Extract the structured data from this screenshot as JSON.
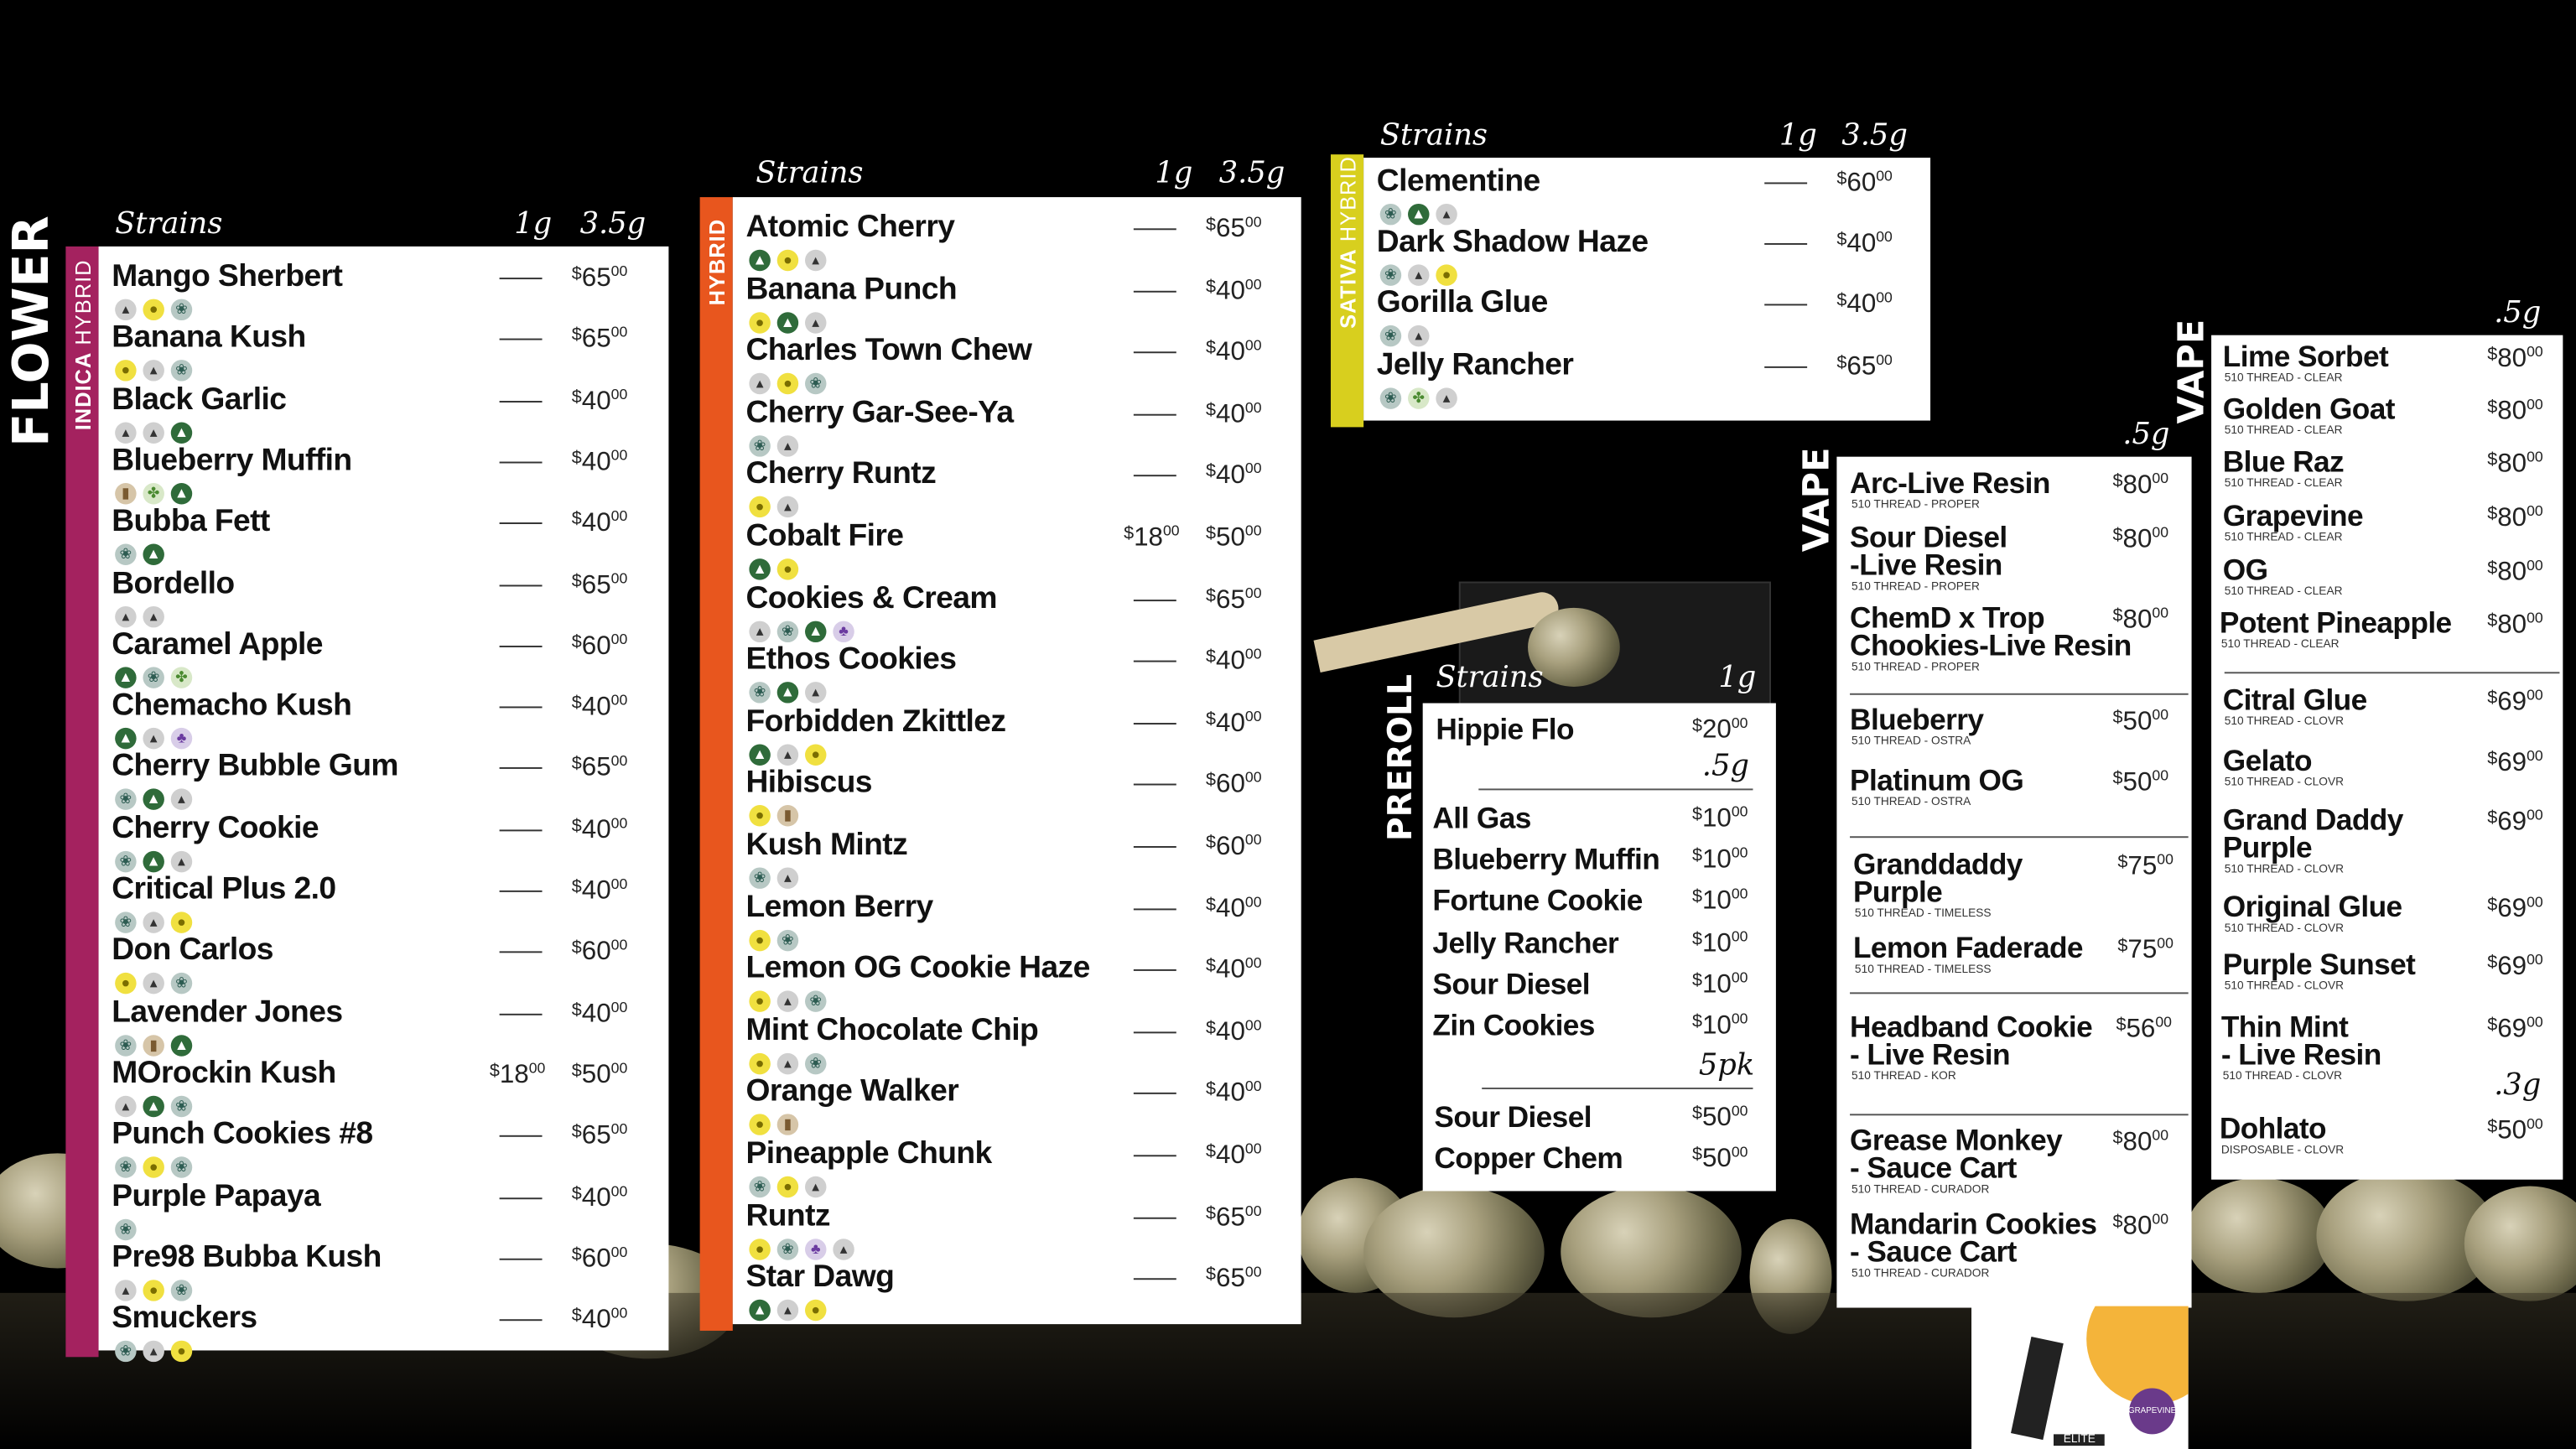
{
  "flower": {
    "title": "FLOWER",
    "sections": [
      {
        "id": "indica_hybrid",
        "label_a": "INDICA",
        "label_b": "HYBRID",
        "color": "#a4225f",
        "headers": {
          "strains": "Strains",
          "g1": "1g",
          "g35": "3.5g"
        },
        "items": [
          {
            "name": "Mango Sherbert",
            "icons": [
              "gray",
              "yellow",
              "teal"
            ],
            "p1": "",
            "p35": "65"
          },
          {
            "name": "Banana Kush",
            "icons": [
              "yellow",
              "gray",
              "teal"
            ],
            "p1": "",
            "p35": "65"
          },
          {
            "name": "Black Garlic",
            "icons": [
              "gray",
              "gray",
              "green"
            ],
            "p1": "",
            "p35": "40"
          },
          {
            "name": "Blueberry Muffin",
            "icons": [
              "brown",
              "lime",
              "green"
            ],
            "p1": "",
            "p35": "40"
          },
          {
            "name": "Bubba Fett",
            "icons": [
              "teal",
              "green"
            ],
            "p1": "",
            "p35": "40"
          },
          {
            "name": "Bordello",
            "icons": [
              "gray",
              "gray"
            ],
            "p1": "",
            "p35": "65"
          },
          {
            "name": "Caramel Apple",
            "icons": [
              "green",
              "teal",
              "lime"
            ],
            "p1": "",
            "p35": "60"
          },
          {
            "name": "Chemacho Kush",
            "icons": [
              "green",
              "gray",
              "purple"
            ],
            "p1": "",
            "p35": "40"
          },
          {
            "name": "Cherry Bubble Gum",
            "icons": [
              "teal",
              "green",
              "gray"
            ],
            "p1": "",
            "p35": "65"
          },
          {
            "name": "Cherry Cookie",
            "icons": [
              "teal",
              "green",
              "gray"
            ],
            "p1": "",
            "p35": "40"
          },
          {
            "name": "Critical Plus 2.0",
            "icons": [
              "teal",
              "gray",
              "yellow"
            ],
            "p1": "",
            "p35": "40"
          },
          {
            "name": "Don Carlos",
            "icons": [
              "yellow",
              "gray",
              "teal"
            ],
            "p1": "",
            "p35": "60"
          },
          {
            "name": "Lavender Jones",
            "icons": [
              "teal",
              "brown",
              "green"
            ],
            "p1": "",
            "p35": "40"
          },
          {
            "name": "MOrockin Kush",
            "icons": [
              "gray",
              "green",
              "teal"
            ],
            "p1": "18",
            "p35": "50"
          },
          {
            "name": "Punch Cookies #8",
            "icons": [
              "teal",
              "yellow",
              "teal"
            ],
            "p1": "",
            "p35": "65"
          },
          {
            "name": "Purple Papaya",
            "icons": [
              "teal"
            ],
            "p1": "",
            "p35": "40"
          },
          {
            "name": "Pre98 Bubba Kush",
            "icons": [
              "gray",
              "yellow",
              "teal"
            ],
            "p1": "",
            "p35": "60"
          },
          {
            "name": "Smuckers",
            "icons": [
              "teal",
              "gray",
              "yellow"
            ],
            "p1": "",
            "p35": "40"
          }
        ]
      },
      {
        "id": "hybrid",
        "label_a": "HYBRID",
        "color": "#e8561e",
        "headers": {
          "strains": "Strains",
          "g1": "1g",
          "g35": "3.5g"
        },
        "items": [
          {
            "name": "Atomic Cherry",
            "icons": [
              "green",
              "yellow",
              "gray"
            ],
            "p1": "",
            "p35": "65"
          },
          {
            "name": "Banana Punch",
            "icons": [
              "yellow",
              "green",
              "gray"
            ],
            "p1": "",
            "p35": "40"
          },
          {
            "name": "Charles Town Chew",
            "icons": [
              "gray",
              "yellow",
              "teal"
            ],
            "p1": "",
            "p35": "40"
          },
          {
            "name": "Cherry Gar-See-Ya",
            "icons": [
              "teal",
              "gray"
            ],
            "p1": "",
            "p35": "40"
          },
          {
            "name": "Cherry Runtz",
            "icons": [
              "yellow",
              "gray"
            ],
            "p1": "",
            "p35": "40"
          },
          {
            "name": "Cobalt Fire",
            "icons": [
              "green",
              "yellow"
            ],
            "p1": "18",
            "p35": "50"
          },
          {
            "name": "Cookies & Cream",
            "icons": [
              "gray",
              "teal",
              "green",
              "purple"
            ],
            "p1": "",
            "p35": "65"
          },
          {
            "name": "Ethos Cookies",
            "icons": [
              "teal",
              "green",
              "gray"
            ],
            "p1": "",
            "p35": "40"
          },
          {
            "name": "Forbidden Zkittlez",
            "icons": [
              "green",
              "gray",
              "yellow"
            ],
            "p1": "",
            "p35": "40"
          },
          {
            "name": "Hibiscus",
            "icons": [
              "yellow",
              "brown"
            ],
            "p1": "",
            "p35": "60"
          },
          {
            "name": "Kush Mintz",
            "icons": [
              "teal",
              "gray"
            ],
            "p1": "",
            "p35": "60"
          },
          {
            "name": "Lemon Berry",
            "icons": [
              "yellow",
              "teal"
            ],
            "p1": "",
            "p35": "40"
          },
          {
            "name": "Lemon OG Cookie Haze",
            "icons": [
              "yellow",
              "gray",
              "teal"
            ],
            "p1": "",
            "p35": "40"
          },
          {
            "name": "Mint Chocolate Chip",
            "icons": [
              "yellow",
              "gray",
              "teal"
            ],
            "p1": "",
            "p35": "40"
          },
          {
            "name": "Orange Walker",
            "icons": [
              "yellow",
              "brown"
            ],
            "p1": "",
            "p35": "40"
          },
          {
            "name": "Pineapple Chunk",
            "icons": [
              "teal",
              "yellow",
              "gray"
            ],
            "p1": "",
            "p35": "40"
          },
          {
            "name": "Runtz",
            "icons": [
              "yellow",
              "teal",
              "purple",
              "gray"
            ],
            "p1": "",
            "p35": "65"
          },
          {
            "name": "Star Dawg",
            "icons": [
              "green",
              "gray",
              "yellow"
            ],
            "p1": "",
            "p35": "65"
          }
        ]
      },
      {
        "id": "sativa_hybrid",
        "label_a": "SATIVA",
        "label_b": "HYBRID",
        "color": "#d8cf1e",
        "headers": {
          "strains": "Strains",
          "g1": "1g",
          "g35": "3.5g"
        },
        "items": [
          {
            "name": "Clementine",
            "icons": [
              "teal",
              "green",
              "gray"
            ],
            "p1": "",
            "p35": "60"
          },
          {
            "name": "Dark Shadow Haze",
            "icons": [
              "teal",
              "gray",
              "yellow"
            ],
            "p1": "",
            "p35": "40"
          },
          {
            "name": "Gorilla Glue",
            "icons": [
              "teal",
              "gray"
            ],
            "p1": "",
            "p35": "40"
          },
          {
            "name": "Jelly Rancher",
            "icons": [
              "teal",
              "lime",
              "gray"
            ],
            "p1": "",
            "p35": "65"
          }
        ]
      }
    ]
  },
  "preroll": {
    "title": "PREROLL",
    "headers": {
      "strains": "Strains",
      "g1": "1g",
      "g05": ".5g",
      "pk5": "5pk"
    },
    "one_gram": [
      {
        "name": "Hippie Flo",
        "price": "20"
      }
    ],
    "half_gram": [
      {
        "name": "All Gas",
        "price": "10"
      },
      {
        "name": "Blueberry Muffin",
        "price": "10"
      },
      {
        "name": "Fortune Cookie",
        "price": "10"
      },
      {
        "name": "Jelly Rancher",
        "price": "10"
      },
      {
        "name": "Sour Diesel",
        "price": "10"
      },
      {
        "name": "Zin Cookies",
        "price": "10"
      }
    ],
    "five_pack": [
      {
        "name": "Sour Diesel",
        "price": "50"
      },
      {
        "name": "Copper Chem",
        "price": "50"
      }
    ]
  },
  "vape1": {
    "title": "VAPE",
    "size": ".5g",
    "items": [
      {
        "name": "Arc-Live Resin",
        "sub": "510 THREAD - PROPER",
        "price": "80"
      },
      {
        "name": "Sour Diesel\n-Live Resin",
        "sub": "510 THREAD - PROPER",
        "price": "80"
      },
      {
        "name": "ChemD x Trop\nChookies-Live Resin",
        "sub": "510 THREAD - PROPER",
        "price": "80"
      },
      {
        "name": "Blueberry",
        "sub": "510 THREAD - OSTRA",
        "price": "50"
      },
      {
        "name": "Platinum OG",
        "sub": "510 THREAD - OSTRA",
        "price": "50"
      },
      {
        "name": "Granddaddy\nPurple",
        "sub": "510 THREAD - TIMELESS",
        "price": "75"
      },
      {
        "name": "Lemon Faderade",
        "sub": "510 THREAD - TIMELESS",
        "price": "75"
      },
      {
        "name": "Headband Cookie\n- Live Resin",
        "sub": "510 THREAD - KOR",
        "price": "56"
      },
      {
        "name": "Grease Monkey\n- Sauce Cart",
        "sub": "510 THREAD - CURADOR",
        "price": "80"
      },
      {
        "name": "Mandarin Cookies\n- Sauce Cart",
        "sub": "510 THREAD - CURADOR",
        "price": "80"
      }
    ]
  },
  "vape2": {
    "title": "VAPE",
    "size": ".5g",
    "size2": ".3g",
    "items": [
      {
        "name": "Lime Sorbet",
        "sub": "510 THREAD - CLEAR",
        "price": "80"
      },
      {
        "name": "Golden Goat",
        "sub": "510 THREAD - CLEAR",
        "price": "80"
      },
      {
        "name": "Blue Raz",
        "sub": "510 THREAD - CLEAR",
        "price": "80"
      },
      {
        "name": "Grapevine",
        "sub": "510 THREAD - CLEAR",
        "price": "80"
      },
      {
        "name": "OG",
        "sub": "510 THREAD - CLEAR",
        "price": "80"
      },
      {
        "name": "Potent Pineapple",
        "sub": "510 THREAD - CLEAR",
        "price": "80"
      },
      {
        "name": "Citral Glue",
        "sub": "510 THREAD - CLOVR",
        "price": "69"
      },
      {
        "name": "Gelato",
        "sub": "510 THREAD - CLOVR",
        "price": "69"
      },
      {
        "name": "Grand Daddy\nPurple",
        "sub": "510 THREAD - CLOVR",
        "price": "69"
      },
      {
        "name": "Original Glue",
        "sub": "510 THREAD - CLOVR",
        "price": "69"
      },
      {
        "name": "Purple Sunset",
        "sub": "510 THREAD - CLOVR",
        "price": "69"
      },
      {
        "name": "Thin Mint\n- Live Resin",
        "sub": "510 THREAD - CLOVR",
        "price": "69"
      },
      {
        "name": "Dohlato",
        "sub": "DISPOSABLE - CLOVR",
        "price": "50"
      }
    ]
  },
  "product": {
    "label": "ELITE",
    "tag": "GRAPEVINE"
  },
  "currency": "$",
  "cents": "00"
}
